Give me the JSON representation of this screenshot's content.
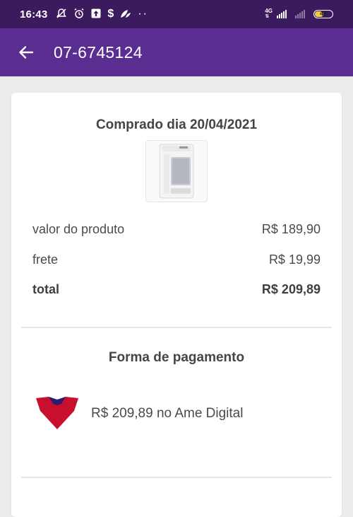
{
  "status_bar": {
    "time": "16:43",
    "network": "4G",
    "battery": "48"
  },
  "header": {
    "title": "07-6745124",
    "back_icon": "arrow-left-icon"
  },
  "order": {
    "purchase_date": "Comprado dia 20/04/2021",
    "product_image_icon": "water-purifier-image",
    "rows": [
      {
        "label": "valor do produto",
        "value": "R$ 189,90"
      },
      {
        "label": "frete",
        "value": "R$ 19,99"
      },
      {
        "label": "total",
        "value": "R$ 209,89"
      }
    ]
  },
  "payment": {
    "title": "Forma de pagamento",
    "method_text": "R$ 209,89 no Ame Digital",
    "logo_icon": "ame-digital-logo"
  },
  "colors": {
    "status_bar": "#3b1a5e",
    "app_bar": "#5a2d91",
    "background": "#ececec",
    "ame_logo": "#c8102e"
  }
}
